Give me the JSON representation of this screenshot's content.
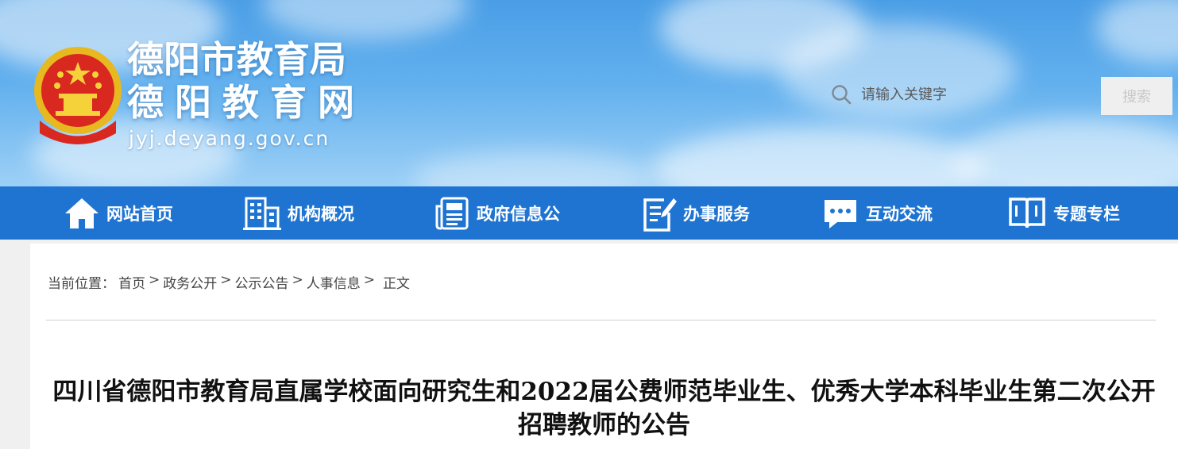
{
  "header": {
    "title_line1": "德阳市教育局",
    "title_line2": "德阳教育网",
    "url": "jyj.deyang.gov.cn",
    "emblem_icon": "national-emblem-icon"
  },
  "search": {
    "placeholder": "请输入关键字",
    "button_label": "搜索"
  },
  "nav": {
    "items": [
      {
        "label": "网站首页",
        "icon": "home-icon"
      },
      {
        "label": "机构概况",
        "icon": "building-icon"
      },
      {
        "label": "政府信息公",
        "icon": "newspaper-icon"
      },
      {
        "label": "办事服务",
        "icon": "edit-document-icon"
      },
      {
        "label": "互动交流",
        "icon": "chat-bubble-icon"
      },
      {
        "label": "专题专栏",
        "icon": "open-book-icon"
      }
    ]
  },
  "breadcrumb": {
    "prefix": "当前位置：",
    "items": [
      "首页",
      "政务公开",
      "公示公告",
      "人事信息"
    ],
    "current": "正文"
  },
  "article": {
    "title": "四川省德阳市教育局直属学校面向研究生和2022届公费师范毕业生、优秀大学本科毕业生第二次公开招聘教师的公告"
  },
  "colors": {
    "nav_bg": "#1f74d2",
    "banner_top": "#4a9ee6"
  }
}
